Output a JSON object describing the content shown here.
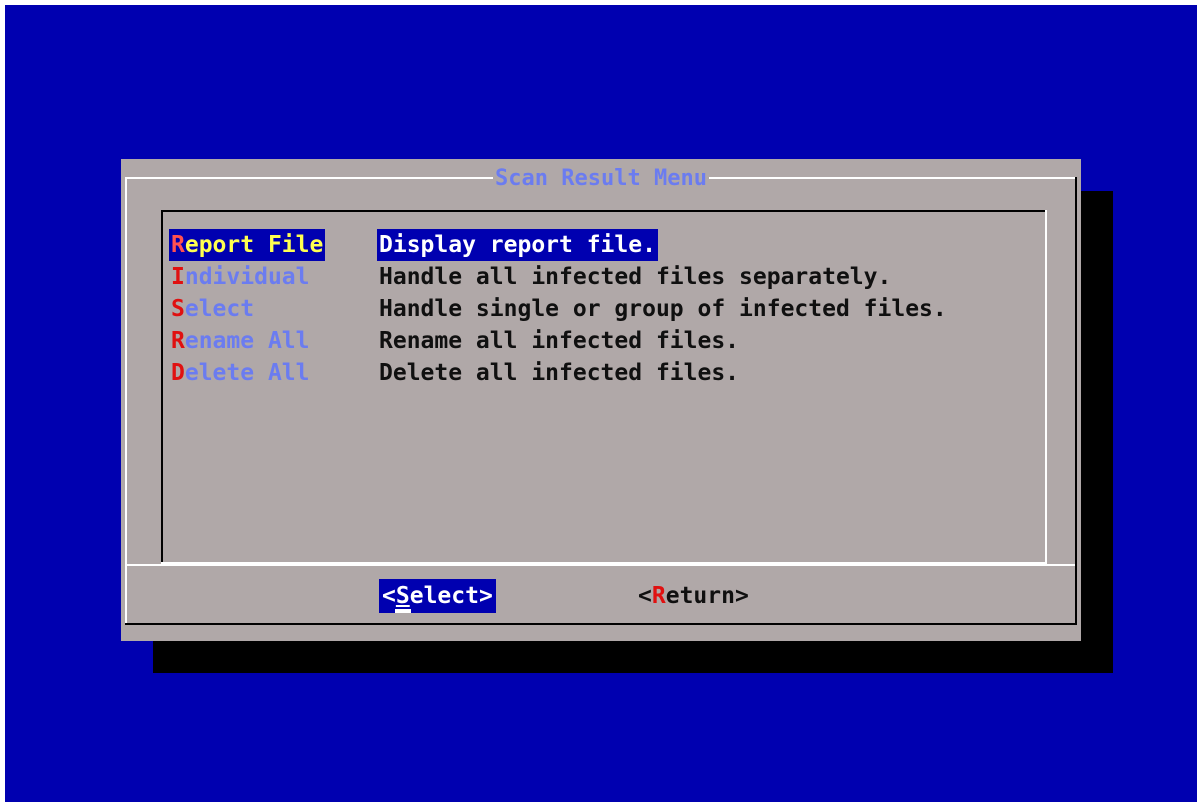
{
  "dialog": {
    "title": "Scan Result Menu"
  },
  "menu": {
    "items": [
      {
        "hotkey": "R",
        "rest": "eport File",
        "description": "Display report file.",
        "selected": true
      },
      {
        "hotkey": "I",
        "rest": "ndividual",
        "description": "Handle all infected files separately.",
        "selected": false
      },
      {
        "hotkey": "S",
        "rest": "elect",
        "description": "Handle single or group of infected files.",
        "selected": false
      },
      {
        "hotkey": "R",
        "rest": "ename All",
        "description": "Rename all infected files.",
        "selected": false
      },
      {
        "hotkey": "D",
        "rest": "elete All",
        "description": "Delete all infected files.",
        "selected": false
      }
    ]
  },
  "buttons": {
    "select": {
      "open": "<",
      "hotkey": "S",
      "rest": "elect",
      "close": ">"
    },
    "return": {
      "open": "<",
      "hotkey": "R",
      "rest": "eturn",
      "close": ">"
    }
  },
  "colors": {
    "background": "#0000b0",
    "dialog": "#b0a8a8",
    "shadow": "#000000",
    "title": "#6b7cf0",
    "hotkey": "#e01010",
    "selected_tag": "#ffff50",
    "selected_desc": "#ffffff"
  }
}
